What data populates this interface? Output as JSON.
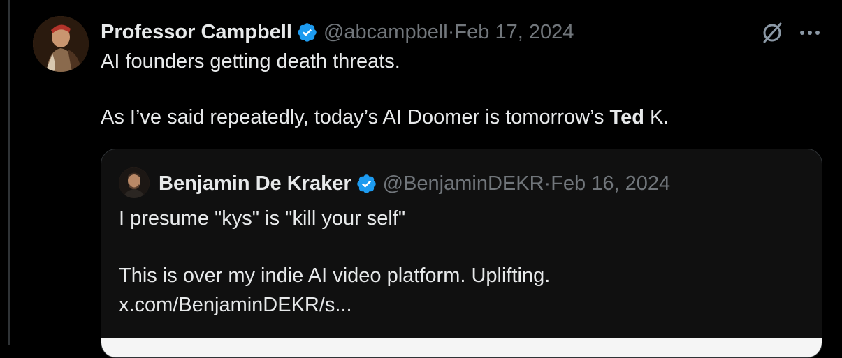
{
  "tweet": {
    "author_name": "Professor Campbell",
    "handle": "@abcampbell",
    "separator": "·",
    "date": "Feb 17, 2024",
    "line1": "AI founders getting death threats.",
    "line2_prefix": "As I’ve said repeatedly, today’s AI Doomer is tomorrow’s ",
    "line2_bold": "Ted",
    "line2_suffix": " K."
  },
  "quoted_tweet": {
    "author_name": "Benjamin De Kraker",
    "handle": "@BenjaminDEKR",
    "separator": "·",
    "date": "Feb 16, 2024",
    "line1": "I presume \"kys\" is \"kill your self\"",
    "line2": "This is over my indie AI video platform. Uplifting.",
    "link": "x.com/BenjaminDEKR/s..."
  },
  "icons": {
    "verified_badge": "verified-badge-icon",
    "grok": "grok-icon",
    "more": "more-icon"
  },
  "colors": {
    "background": "#000000",
    "text": "#e7e9ea",
    "muted": "#71767b",
    "verified": "#1d9bf0",
    "border": "#2f3336"
  }
}
